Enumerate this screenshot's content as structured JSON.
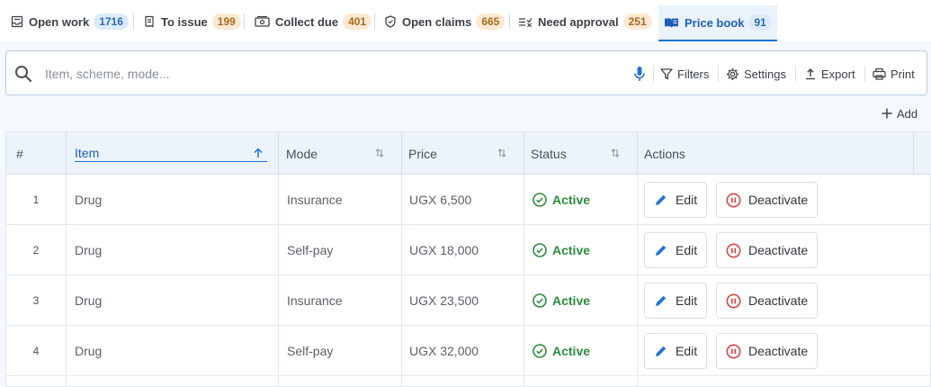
{
  "tabs": [
    {
      "label": "Open work",
      "count": "1716",
      "icon": "inbox-icon",
      "badge": "blue"
    },
    {
      "label": "To issue",
      "count": "199",
      "icon": "receipt-icon",
      "badge": "orange"
    },
    {
      "label": "Collect due",
      "count": "401",
      "icon": "cash-icon",
      "badge": "orange"
    },
    {
      "label": "Open claims",
      "count": "665",
      "icon": "shield-icon",
      "badge": "orange"
    },
    {
      "label": "Need approval",
      "count": "251",
      "icon": "checklist-icon",
      "badge": "orange"
    },
    {
      "label": "Price book",
      "count": "91",
      "icon": "book-icon",
      "badge": "blue",
      "active": true
    }
  ],
  "search": {
    "placeholder": "Item, scheme, mode..."
  },
  "toolbar": {
    "filters": "Filters",
    "settings": "Settings",
    "export": "Export",
    "print": "Print",
    "add": "Add"
  },
  "table": {
    "columns": {
      "num": "#",
      "item": "Item",
      "mode": "Mode",
      "price": "Price",
      "status": "Status",
      "actions": "Actions"
    },
    "sorted_column": "Item",
    "sort_direction": "ascending",
    "rows": [
      {
        "num": "1",
        "item": "Drug",
        "mode": "Insurance",
        "price": "UGX 6,500",
        "status": "Active",
        "edit": "Edit",
        "deactivate": "Deactivate"
      },
      {
        "num": "2",
        "item": "Drug",
        "mode": "Self-pay",
        "price": "UGX 18,000",
        "status": "Active",
        "edit": "Edit",
        "deactivate": "Deactivate"
      },
      {
        "num": "3",
        "item": "Drug",
        "mode": "Insurance",
        "price": "UGX 23,500",
        "status": "Active",
        "edit": "Edit",
        "deactivate": "Deactivate"
      },
      {
        "num": "4",
        "item": "Drug",
        "mode": "Self-pay",
        "price": "UGX 32,000",
        "status": "Active",
        "edit": "Edit",
        "deactivate": "Deactivate"
      }
    ]
  },
  "colors": {
    "accent": "#1f73d8",
    "active_status": "#2e8b3e",
    "deactivate": "#d64545"
  }
}
